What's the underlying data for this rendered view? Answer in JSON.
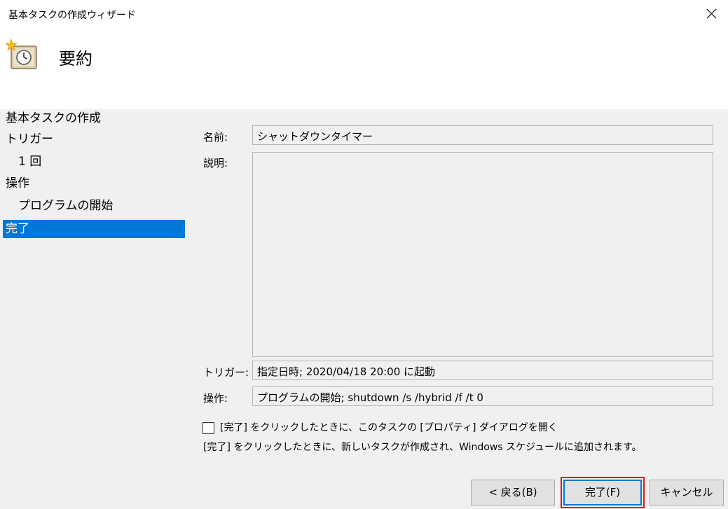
{
  "window": {
    "title": "基本タスクの作成ウィザード",
    "close_icon": "close-icon"
  },
  "header": {
    "icon": "scheduled-task-clock-icon",
    "heading": "要約"
  },
  "nav": {
    "items": [
      {
        "label": "基本タスクの作成",
        "level": 0,
        "active": false
      },
      {
        "label": "トリガー",
        "level": 0,
        "active": false
      },
      {
        "label": "1 回",
        "level": 1,
        "active": false
      },
      {
        "label": "操作",
        "level": 0,
        "active": false
      },
      {
        "label": "プログラムの開始",
        "level": 1,
        "active": false
      },
      {
        "label": "完了",
        "level": 0,
        "active": true
      }
    ],
    "active_color": "#0078d7"
  },
  "summary": {
    "name_label": "名前:",
    "name_value": "シャットダウンタイマー",
    "description_label": "説明:",
    "description_value": "",
    "trigger_label": "トリガー:",
    "trigger_value": "指定日時; 2020/04/18 20:00 に起動",
    "action_label": "操作:",
    "action_value": "プログラムの開始; shutdown /s /hybrid /f /t 0"
  },
  "options": {
    "open_properties_label": "[完了] をクリックしたときに、このタスクの [プロパティ] ダイアログを開く",
    "open_properties_checked": false,
    "note": "[完了] をクリックしたときに、新しいタスクが作成され、Windows スケジュールに追加されます。"
  },
  "buttons": {
    "back": "< 戻る(B)",
    "finish": "完了(F)",
    "cancel": "キャンセル"
  }
}
